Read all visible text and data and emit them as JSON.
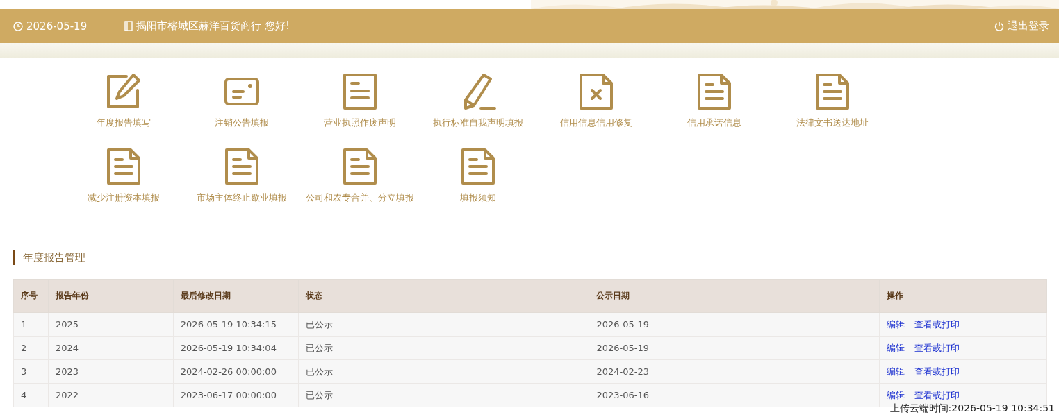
{
  "header": {
    "date": "2026-05-19",
    "greeting": "揭阳市榕城区赫洋百货商行 您好!",
    "logout": "退出登录"
  },
  "menu": [
    {
      "label": "年度报告填写"
    },
    {
      "label": "注销公告填报"
    },
    {
      "label": "营业执照作废声明"
    },
    {
      "label": "执行标准自我声明填报"
    },
    {
      "label": "信用信息信用修复"
    },
    {
      "label": "信用承诺信息"
    },
    {
      "label": "法律文书送达地址"
    },
    {
      "label": "减少注册资本填报"
    },
    {
      "label": "市场主体终止歇业填报"
    },
    {
      "label": "公司和农专合并、分立填报"
    },
    {
      "label": "填报须知"
    }
  ],
  "section": {
    "title": "年度报告管理"
  },
  "table": {
    "columns": [
      "序号",
      "报告年份",
      "最后修改日期",
      "状态",
      "公示日期",
      "操作"
    ],
    "rows": [
      {
        "index": "1",
        "year": "2025",
        "modified": "2026-05-19 10:34:15",
        "status": "已公示",
        "published": "2026-05-19",
        "actions": [
          "编辑",
          "查看或打印"
        ]
      },
      {
        "index": "2",
        "year": "2024",
        "modified": "2026-05-19 10:34:04",
        "status": "已公示",
        "published": "2026-05-19",
        "actions": [
          "编辑",
          "查看或打印"
        ]
      },
      {
        "index": "3",
        "year": "2023",
        "modified": "2024-02-26 00:00:00",
        "status": "已公示",
        "published": "2024-02-23",
        "actions": [
          "编辑",
          "查看或打印"
        ]
      },
      {
        "index": "4",
        "year": "2022",
        "modified": "2023-06-17 00:00:00",
        "status": "已公示",
        "published": "2023-06-16",
        "actions": [
          "编辑",
          "查看或打印"
        ]
      }
    ]
  },
  "upload_time": "上传云端时间:2026-05-19 10:34:51"
}
